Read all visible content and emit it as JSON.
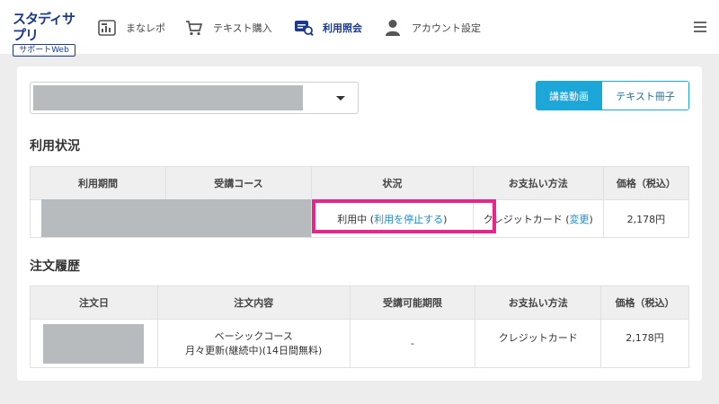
{
  "header": {
    "logo_top": "スタディサプリ",
    "logo_bottom": "サポートWeb",
    "nav": [
      {
        "label": "まなレポ",
        "icon": "report-icon"
      },
      {
        "label": "テキスト購入",
        "icon": "cart-icon"
      },
      {
        "label": "利用照会",
        "icon": "inquiry-icon",
        "active": true
      },
      {
        "label": "アカウント設定",
        "icon": "user-icon"
      }
    ]
  },
  "toggle": {
    "lecture": "講義動画",
    "text": "テキスト冊子"
  },
  "usage": {
    "title": "利用状況",
    "headers": [
      "利用期間",
      "受講コース",
      "状況",
      "お支払い方法",
      "価格（税込）"
    ],
    "row": {
      "status_prefix": "利用中 (",
      "status_link": "利用を停止する",
      "status_suffix": ")",
      "payment_prefix": "クレジットカード (",
      "payment_link": "変更",
      "payment_suffix": ")",
      "price": "2,178円"
    }
  },
  "orders": {
    "title": "注文履歴",
    "headers": [
      "注文日",
      "注文内容",
      "受講可能期限",
      "お支払い方法",
      "価格（税込）"
    ],
    "row": {
      "content_line1": "ベーシックコース",
      "content_line2": "月々更新(継続中)(14日間無料)",
      "deadline": "-",
      "payment": "クレジットカード",
      "price": "2,178円"
    }
  },
  "colors": {
    "accent": "#1da6d8",
    "brand": "#1b3a8c",
    "highlight": "#e6268a"
  }
}
